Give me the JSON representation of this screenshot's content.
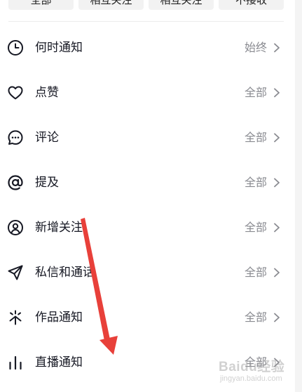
{
  "top_buttons": [
    "全部",
    "相互关注",
    "相互关注",
    "不接收"
  ],
  "rows": [
    {
      "icon": "clock-icon",
      "label": "何时通知",
      "value": "始终"
    },
    {
      "icon": "heart-icon",
      "label": "点赞",
      "value": "全部"
    },
    {
      "icon": "comment-icon",
      "label": "评论",
      "value": "全部"
    },
    {
      "icon": "at-icon",
      "label": "提及",
      "value": "全部"
    },
    {
      "icon": "user-circle-icon",
      "label": "新增关注",
      "value": "全部"
    },
    {
      "icon": "send-icon",
      "label": "私信和通话",
      "value": "全部"
    },
    {
      "icon": "sparkle-icon",
      "label": "作品通知",
      "value": "全部"
    },
    {
      "icon": "bar-chart-icon",
      "label": "直播通知",
      "value": "全部"
    }
  ],
  "watermark": {
    "brand": "Baidu经验",
    "domain": "jingyan.baidu.com"
  },
  "colors": {
    "label": "#161823",
    "value": "#8a8b91",
    "arrow": "#e8403a"
  }
}
